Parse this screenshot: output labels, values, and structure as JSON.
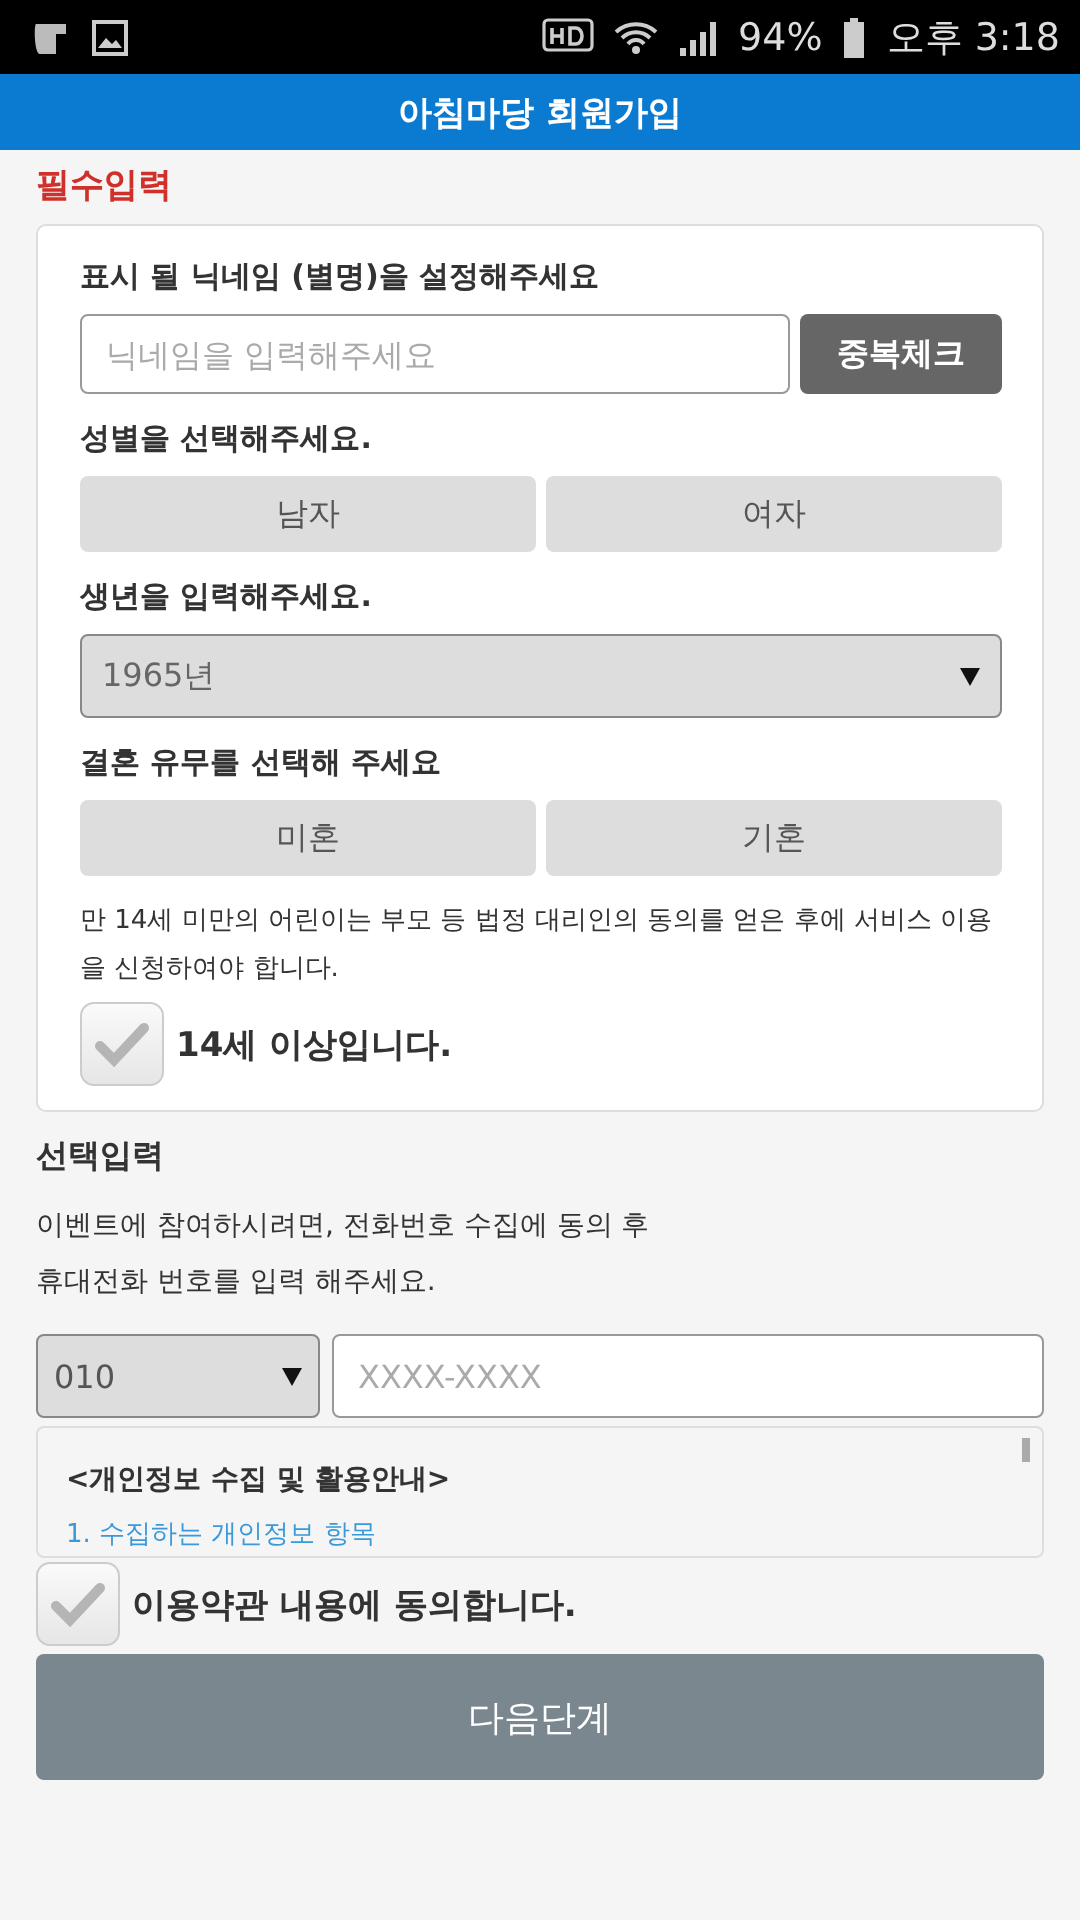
{
  "status_bar": {
    "battery": "94%",
    "time": "오후 3:18"
  },
  "header": {
    "title": "아침마당 회원가입"
  },
  "required": {
    "heading": "필수입력",
    "nickname": {
      "label": "표시 될 닉네임 (별명)을 설정해주세요",
      "placeholder": "닉네임을 입력해주세요",
      "button": "중복체크"
    },
    "gender": {
      "label": "성별을 선택해주세요.",
      "options": [
        {
          "label": "남자",
          "selected": false
        },
        {
          "label": "여자",
          "selected": false
        }
      ]
    },
    "birth_year": {
      "label": "생년을 입력해주세요.",
      "value": "1965년"
    },
    "marriage": {
      "label": "결혼 유무를 선택해 주세요",
      "options": [
        {
          "label": "미혼",
          "selected": false
        },
        {
          "label": "기혼",
          "selected": false
        }
      ]
    },
    "notice": "만 14세 미만의 어린이는 부모 등 법정 대리인의 동의를 얻은 후에 서비스 이용을 신청하여야 합니다.",
    "age_check": {
      "label": "14세 이상입니다.",
      "checked": false
    }
  },
  "optional": {
    "heading": "선택입력",
    "description": [
      "이벤트에 참여하시려면, 전화번호 수집에 동의 후",
      "휴대전화 번호를 입력 해주세요."
    ],
    "phone": {
      "prefix": "010",
      "placeholder": "XXXX-XXXX"
    },
    "terms": {
      "title": "<개인정보 수집 및 활용안내>",
      "item": "1. 수집하는 개인정보 항목"
    },
    "agree": {
      "label": "이용약관 내용에 동의합니다.",
      "checked": false
    }
  },
  "next_button": "다음단계"
}
